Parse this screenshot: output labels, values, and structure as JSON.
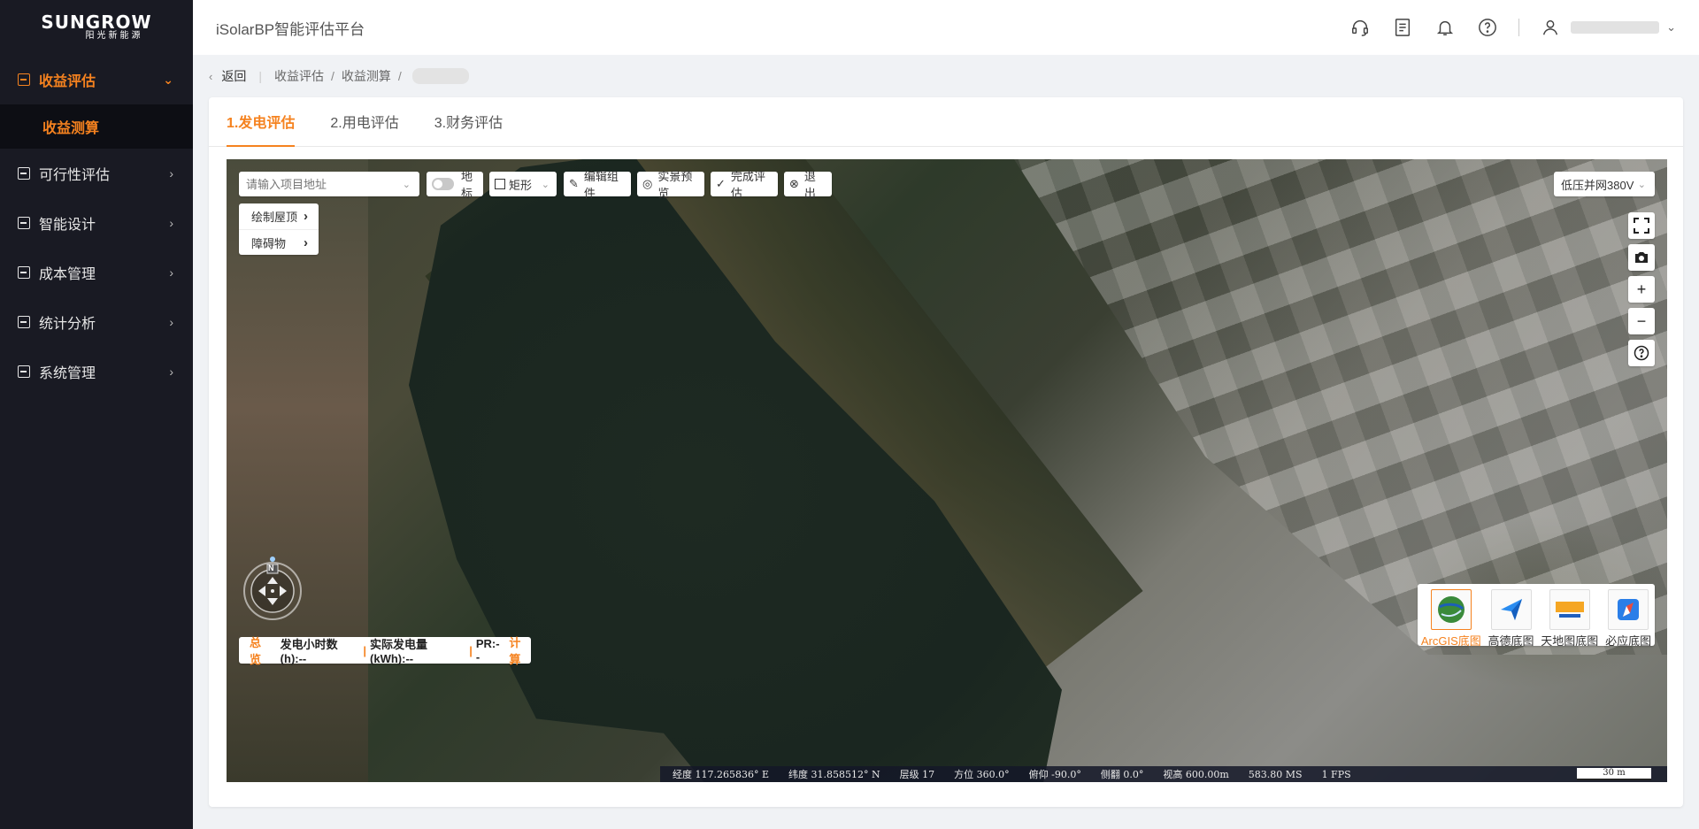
{
  "logo": {
    "main": "SUNGROW",
    "sub": "阳光新能源"
  },
  "sidebar": {
    "items": [
      {
        "label": "收益评估",
        "active": true,
        "expanded": true,
        "children": [
          {
            "label": "收益测算",
            "active": true
          }
        ]
      },
      {
        "label": "可行性评估"
      },
      {
        "label": "智能设计"
      },
      {
        "label": "成本管理"
      },
      {
        "label": "统计分析"
      },
      {
        "label": "系统管理"
      }
    ]
  },
  "header": {
    "title": "iSolarBP智能评估平台",
    "icons": [
      "headset-icon",
      "document-icon",
      "bell-icon",
      "help-icon",
      "user-icon"
    ]
  },
  "breadcrumb": {
    "back_label": "返回",
    "items": [
      "收益评估",
      "收益测算"
    ]
  },
  "tabs": [
    {
      "label": "1.发电评估",
      "active": true
    },
    {
      "label": "2.用电评估",
      "active": false
    },
    {
      "label": "3.财务评估",
      "active": false
    }
  ],
  "map_toolbar": {
    "search_placeholder": "请输入项目地址",
    "landmark_label": "地标",
    "shape_label": "矩形",
    "edit_label": "编辑组件",
    "preview_label": "实景预览",
    "finish_label": "完成评估",
    "exit_label": "退出",
    "grid_option": "低压并网380V"
  },
  "draw_panel": {
    "items": [
      "绘制屋顶",
      "障碍物"
    ]
  },
  "summary": {
    "overview": "总览",
    "hours": "发电小时数(h):--",
    "energy": "实际发电量(kWh):--",
    "pr": "PR:--",
    "calc": "计算"
  },
  "basemaps": [
    {
      "label": "ArcGIS底图",
      "active": true
    },
    {
      "label": "高德底图",
      "active": false
    },
    {
      "label": "天地图底图",
      "active": false
    },
    {
      "label": "必应底图",
      "active": false
    }
  ],
  "statusbar": {
    "lon": "经度  117.265836° E",
    "lat": "纬度  31.858512° N",
    "level": "层级  17",
    "heading": "方位  360.0°",
    "pitch": "俯仰  -90.0°",
    "roll": "侧翻  0.0°",
    "height": "视高  600.00m",
    "ms": "583.80 MS",
    "fps": "1 FPS",
    "scale": "30 m"
  },
  "compass": {
    "north": "N"
  },
  "colors": {
    "accent": "#f5821f",
    "sidebar_bg": "#191a23"
  }
}
